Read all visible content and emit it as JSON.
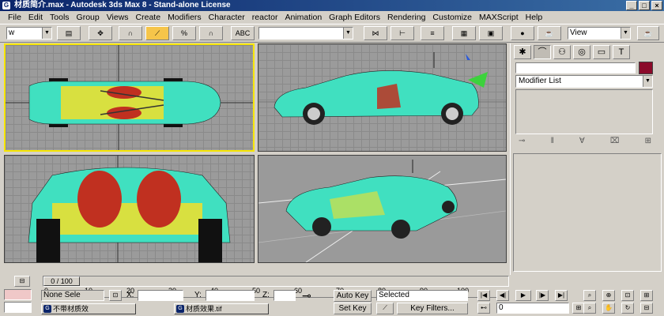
{
  "window": {
    "title": "材质简介.max - Autodesk 3ds Max 8 - Stand-alone License"
  },
  "menu": [
    "File",
    "Edit",
    "Tools",
    "Group",
    "Views",
    "Create",
    "Modifiers",
    "Character",
    "reactor",
    "Animation",
    "Graph Editors",
    "Rendering",
    "Customize",
    "MAXScript",
    "Help"
  ],
  "toolbar": {
    "selection_filter": "w",
    "named_selection": "",
    "ref_coord": "View"
  },
  "command_panel": {
    "modifier_list_label": "Modifier List",
    "object_color": "#8b0a2a"
  },
  "viewports": [
    "top",
    "front",
    "left",
    "perspective"
  ],
  "timeline": {
    "slider_label": "0 / 100",
    "ticks": [
      "0",
      "10",
      "20",
      "30",
      "40",
      "50",
      "60",
      "70",
      "80",
      "90",
      "100"
    ]
  },
  "status": {
    "selection": "None Sele",
    "x_label": "X:",
    "y_label": "Y:",
    "z_label": "Z:",
    "x_value": "",
    "y_value": "",
    "z_value": "",
    "auto_key": "Auto Key",
    "set_key": "Set Key",
    "selected_dropdown": "Selected",
    "key_filters": "Key Filters...",
    "frame": "0"
  },
  "taskbar": {
    "item1": "不带材质效",
    "item2": "材质效果.tif"
  },
  "colors": {
    "car_body": "#40e0c0",
    "seat": "#c03020",
    "interior": "#d8e040",
    "active_viewport": "#f7e600"
  }
}
